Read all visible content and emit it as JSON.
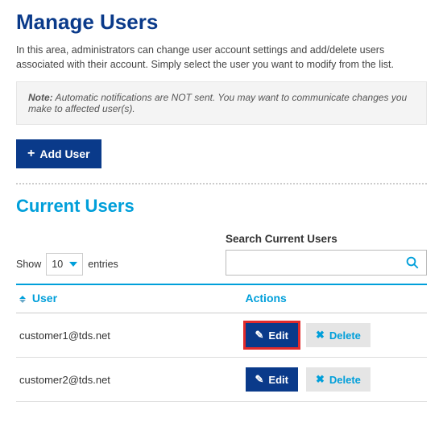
{
  "page": {
    "title": "Manage Users",
    "intro": "In this area, administrators can change user account settings and add/delete users associated with their account. Simply select the user you want to modify from the list.",
    "note_label": "Note:",
    "note_text": " Automatic notifications are NOT sent. You may want to communicate changes you make to affected user(s)."
  },
  "add_user_label": "Add User",
  "section_title": "Current Users",
  "entries": {
    "show_label": "Show",
    "entries_label": "entries",
    "value": "10"
  },
  "search": {
    "label": "Search Current Users",
    "value": ""
  },
  "table": {
    "col_user": "User",
    "col_actions": "Actions",
    "edit_label": "Edit",
    "delete_label": "Delete",
    "rows": [
      {
        "user": "customer1@tds.net"
      },
      {
        "user": "customer2@tds.net"
      }
    ]
  }
}
